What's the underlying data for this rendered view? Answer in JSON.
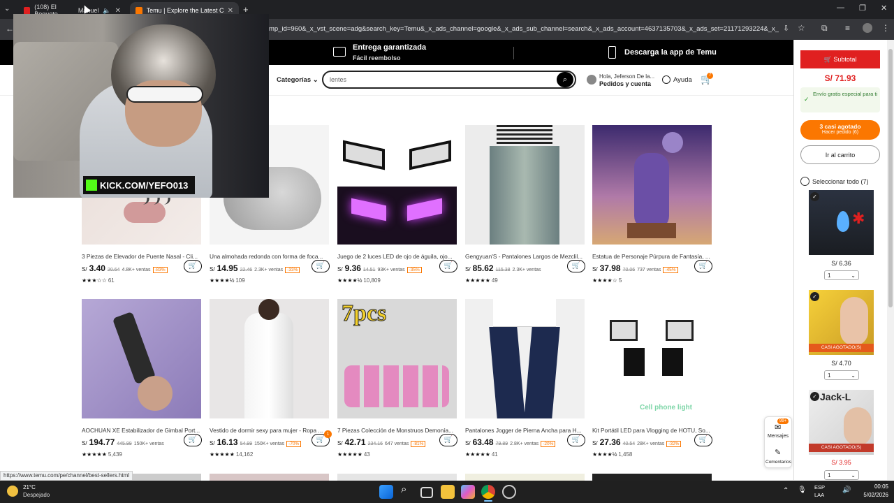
{
  "browser": {
    "tabs": [
      {
        "label": "(108) El Bogueto",
        "label2": "Manuel"
      },
      {
        "label": "Temu | Explore the Latest Cloth"
      }
    ],
    "url": "mp_id=960&_x_vst_scene=adg&search_key=Temu&_x_ads_channel=google&_x_ads_sub_channel=search&_x_ads_account=4637135703&_x_ads_set=21171293224&_x_ads_id...",
    "status_url": "https://www.temu.com/pe/channel/best-sellers.html"
  },
  "topstrip": {
    "delivery_title": "Entrega garantizada",
    "delivery_sub": "Fácil reembolso",
    "app": "Descarga la app de Temu"
  },
  "header": {
    "categories": "Categorías",
    "search_value": "lentes",
    "greeting": "Hola, Jeferson De la...",
    "account": "Pedidos y cuenta",
    "help": "Ayuda",
    "cart_count": "7"
  },
  "webcam": {
    "overlay_text": "KICK.COM/YEFO013"
  },
  "products": [
    {
      "title": "3 Piezas de Elevador de Puente Nasal - Cli...",
      "cur": "S/",
      "price": "3.40",
      "old": "20.64",
      "sold": "4.8K+ ventas",
      "disc": "-83%",
      "stars": "★★★☆☆",
      "reviews": "61"
    },
    {
      "title": "Una almohada redonda con forma de foca...",
      "cur": "S/",
      "price": "14.95",
      "old": "22.46",
      "sold": "2.3K+ ventas",
      "disc": "-33%",
      "stars": "★★★★½",
      "reviews": "109"
    },
    {
      "title": "Juego de 2 luces LED de ojo de águila, ojo...",
      "cur": "S/",
      "price": "9.36",
      "old": "14.51",
      "sold": "93K+ ventas",
      "disc": "-35%",
      "stars": "★★★★½",
      "reviews": "10,809"
    },
    {
      "title": "Gengyuan'S - Pantalones Largos de Mezclil...",
      "cur": "S/",
      "price": "85.62",
      "old": "115.38",
      "sold": "2.3K+ ventas",
      "disc": "",
      "stars": "★★★★★",
      "reviews": "49"
    },
    {
      "title": "Estatua de Personaje Púrpura de Fantasía, ...",
      "cur": "S/",
      "price": "37.98",
      "old": "70.06",
      "sold": "737 ventas",
      "disc": "-45%",
      "stars": "★★★★☆",
      "reviews": "5"
    },
    {
      "title": "AOCHUAN XE Estabilizador de Gimbal Port...",
      "cur": "S/",
      "price": "194.77",
      "old": "445.99",
      "sold": "150K+ ventas",
      "disc": "",
      "stars": "★★★★★",
      "reviews": "5,439"
    },
    {
      "title": "Vestido de dormir sexy para mujer - Ropa ...",
      "cur": "S/",
      "price": "16.13",
      "old": "54.99",
      "sold": "150K+ ventas",
      "disc": "-70%",
      "stars": "★★★★★",
      "reviews": "14,162",
      "badge": "1"
    },
    {
      "title": "7 Piezas Colección de Monstruos Demonía...",
      "cur": "S/",
      "price": "42.71",
      "old": "234.16",
      "sold": "647 ventas",
      "disc": "-81%",
      "stars": "★★★★★",
      "reviews": "43"
    },
    {
      "title": "Pantalones Jogger de Pierna Ancha para H...",
      "cur": "S/",
      "price": "63.48",
      "old": "79.89",
      "sold": "2.8K+ ventas",
      "disc": "-20%",
      "stars": "★★★★★",
      "reviews": "41"
    },
    {
      "title": "Kit Portátil LED para Vlogging de HOTU, So...",
      "cur": "S/",
      "price": "27.36",
      "old": "40.54",
      "sold": "28K+ ventas",
      "disc": "-32%",
      "stars": "★★★★½",
      "reviews": "1,458"
    }
  ],
  "cart": {
    "subtotal_label": "Subtotal",
    "subtotal": "S/ 71.93",
    "free_shipping": "Envío gratis especial para ti",
    "almost_sold": "3 casi agotado",
    "place_order": "Hacer pedido (6)",
    "go_cart": "Ir al carrito",
    "select_all": "Seleccionar todo (7)",
    "items": [
      {
        "price": "S/ 6.36",
        "qty": "1",
        "tag": ""
      },
      {
        "price": "S/ 4.70",
        "qty": "1",
        "tag": "CASI AGOTADO(S)"
      },
      {
        "price": "S/ 3.95",
        "qty": "1",
        "tag": "CASI AGOTADO(S)",
        "text": "Jack-L"
      }
    ],
    "messages_badge": "99+",
    "messages": "Mensajes",
    "comments": "Comentarios"
  },
  "gimbal_text": "7pcs",
  "light_text": "Cell phone light",
  "taskbar": {
    "temp": "21°C",
    "weather": "Despejado",
    "lang1": "ESP",
    "lang2": "LAA",
    "time": "00:05",
    "date": "5/02/2026"
  },
  "colors": {
    "accent": "#fb7701",
    "cart_red": "#e02020"
  }
}
